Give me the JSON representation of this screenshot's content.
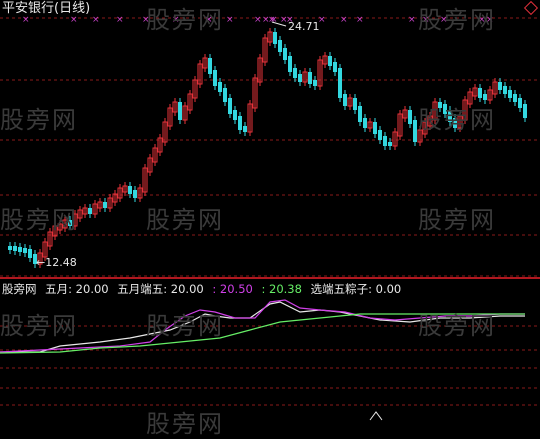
{
  "header": {
    "title": "平安银行(日线)"
  },
  "watermark": "股旁网",
  "price_labels": {
    "high": "24.71",
    "low": "12.48",
    "low_prefix": "←"
  },
  "indicator": {
    "name": "股旁网",
    "items": [
      {
        "label": "五月: 20.00",
        "color": "#e8e8e8"
      },
      {
        "label": "五月端五: 20.00",
        "color": "#e8e8e8"
      },
      {
        "label": ": 20.50",
        "color": "#d040e8"
      },
      {
        "label": ": 20.38",
        "color": "#66ee66"
      },
      {
        "label": "选端五粽子: 0.00",
        "color": "#e8e8e8"
      }
    ]
  },
  "colors": {
    "up": "#e8333a",
    "down": "#33d8e0",
    "grid": "#8a1a1a",
    "marker": "#cc44cc"
  }
}
